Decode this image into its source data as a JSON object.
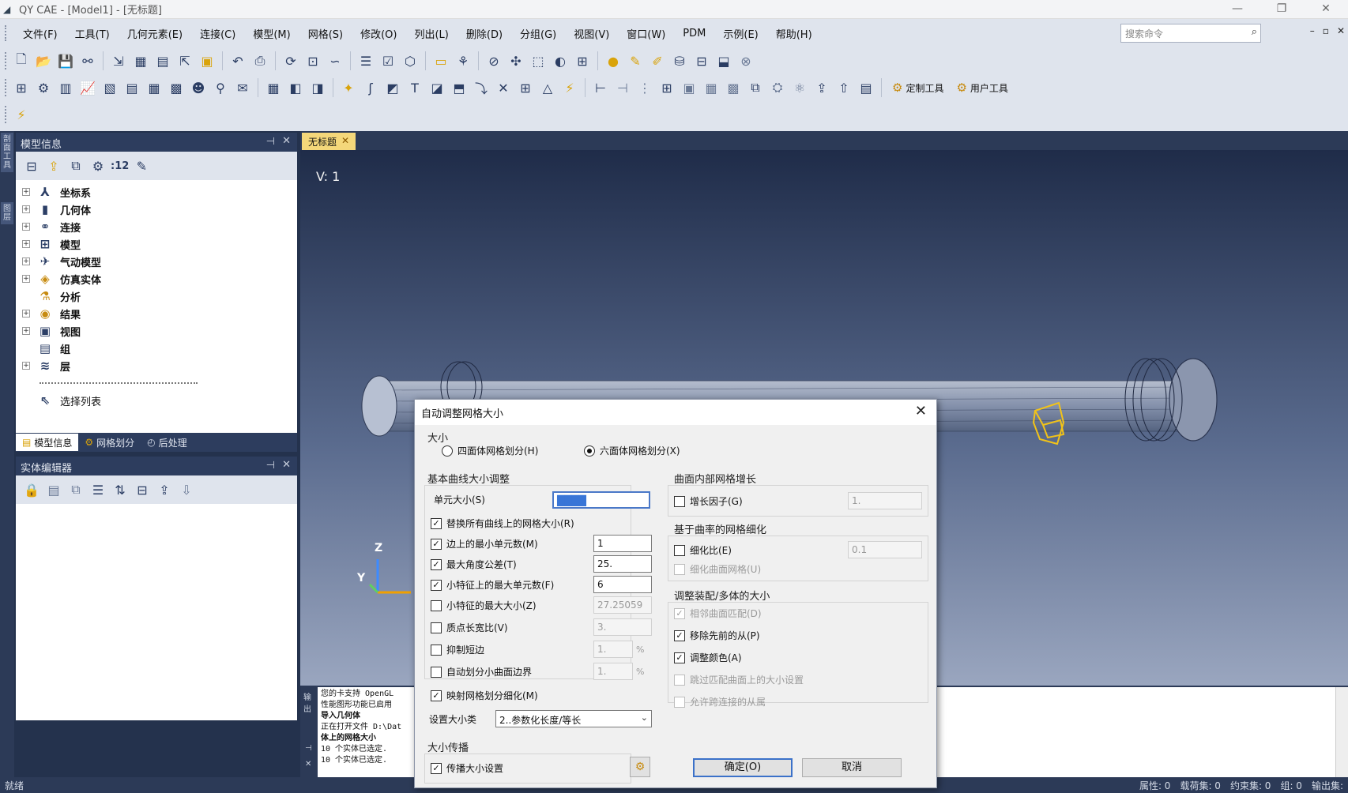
{
  "window": {
    "title": "QY CAE - [Model1] - [无标题]"
  },
  "window_controls": [
    "—",
    "❐",
    "✕"
  ],
  "menu": [
    "文件(F)",
    "工具(T)",
    "几何元素(E)",
    "连接(C)",
    "模型(M)",
    "网格(S)",
    "修改(O)",
    "列出(L)",
    "删除(D)",
    "分组(G)",
    "视图(V)",
    "窗口(W)",
    "PDM",
    "示例(E)",
    "帮助(H)"
  ],
  "search": {
    "placeholder": "搜索命令"
  },
  "toolbar": {
    "custom_tools": "定制工具",
    "user_tools": "用户工具",
    "number_filter": ":12"
  },
  "model_panel": {
    "title": "模型信息",
    "tree": [
      {
        "label": "坐标系",
        "icon": "axes-icon",
        "expandable": true
      },
      {
        "label": "几何体",
        "icon": "cylinder-icon",
        "expandable": true
      },
      {
        "label": "连接",
        "icon": "connection-icon",
        "expandable": true
      },
      {
        "label": "模型",
        "icon": "grid-icon",
        "expandable": true
      },
      {
        "label": "气动模型",
        "icon": "aero-icon",
        "expandable": true
      },
      {
        "label": "仿真实体",
        "icon": "simulation-icon",
        "expandable": true
      },
      {
        "label": "分析",
        "icon": "analysis-icon",
        "expandable": false
      },
      {
        "label": "结果",
        "icon": "result-icon",
        "expandable": true
      },
      {
        "label": "视图",
        "icon": "view-icon",
        "expandable": true
      },
      {
        "label": "组",
        "icon": "group-icon",
        "expandable": false
      },
      {
        "label": "层",
        "icon": "layers-icon",
        "expandable": true
      }
    ],
    "select_list": "选择列表",
    "tabs": [
      "模型信息",
      "网格划分",
      "后处理"
    ]
  },
  "entity_panel": {
    "title": "实体编辑器"
  },
  "left_strip_tabs": [
    "剖面工具",
    "图层"
  ],
  "document": {
    "tab": "无标题",
    "view_label": "V: 1"
  },
  "triad": {
    "z": "Z",
    "y": "Y"
  },
  "console": {
    "side_labels": [
      "输出",
      "⊣",
      "✕"
    ],
    "lines": [
      "您的卡支持 OpenGL",
      "性能图形功能已启用",
      "导入几何体",
      "正在打开文件 D:\\Dat",
      "体上的网格大小",
      "10 个实体已选定.",
      "10 个实体已选定."
    ]
  },
  "status": {
    "ready": "就绪",
    "items": [
      "属性: 0",
      "载荷集: 0",
      "约束集: 0",
      "组: 0",
      "输出集: "
    ]
  },
  "dialog": {
    "title": "自动调整网格大小",
    "size_group": "大小",
    "radio_tet": "四面体网格划分(H)",
    "radio_hex": "六面体网格划分(X)",
    "radio_selected": "hex",
    "basic_group": "基本曲线大小调整",
    "elem_size_label": "单元大小(S)",
    "elem_size_value": "████",
    "options": [
      {
        "label": "替换所有曲线上的网格大小(R)",
        "checked": true,
        "field": null
      },
      {
        "label": "边上的最小单元数(M)",
        "checked": true,
        "field": "1"
      },
      {
        "label": "最大角度公差(T)",
        "checked": true,
        "field": "25."
      },
      {
        "label": "小特征上的最大单元数(F)",
        "checked": true,
        "field": "6"
      },
      {
        "label": "小特征的最大大小(Z)",
        "checked": false,
        "field": "27.25059"
      },
      {
        "label": "质点长宽比(V)",
        "checked": false,
        "field": "3."
      },
      {
        "label": "抑制短边",
        "checked": false,
        "field": "1.",
        "pct": "%"
      },
      {
        "label": "自动划分小曲面边界",
        "checked": false,
        "field": "1.",
        "pct": "%"
      },
      {
        "label": "映射网格划分细化(M)",
        "checked": true,
        "field": null
      }
    ],
    "size_type_label": "设置大小类",
    "size_type_value": "2..参数化长度/等长",
    "prop_group": "大小传播",
    "prop_option": "传播大小设置",
    "growth_group": "曲面内部网格增长",
    "growth_factor_label": "增长因子(G)",
    "growth_factor_value": "1.",
    "curv_group": "基于曲率的网格细化",
    "refine_ratio_label": "细化比(E)",
    "refine_ratio_value": "0.1",
    "refine_surface_label": "细化曲面网格(U)",
    "assembly_group": "调整装配/多体的大小",
    "match_adjacent_label": "相邻曲面匹配(D)",
    "remove_prev_label": "移除先前的从(P)",
    "adjust_color_label": "调整颜色(A)",
    "skip_matched_label": "跳过匹配曲面上的大小设置",
    "allow_chain_label": "允许跨连接的从属",
    "ok": "确定(O)",
    "cancel": "取消"
  }
}
